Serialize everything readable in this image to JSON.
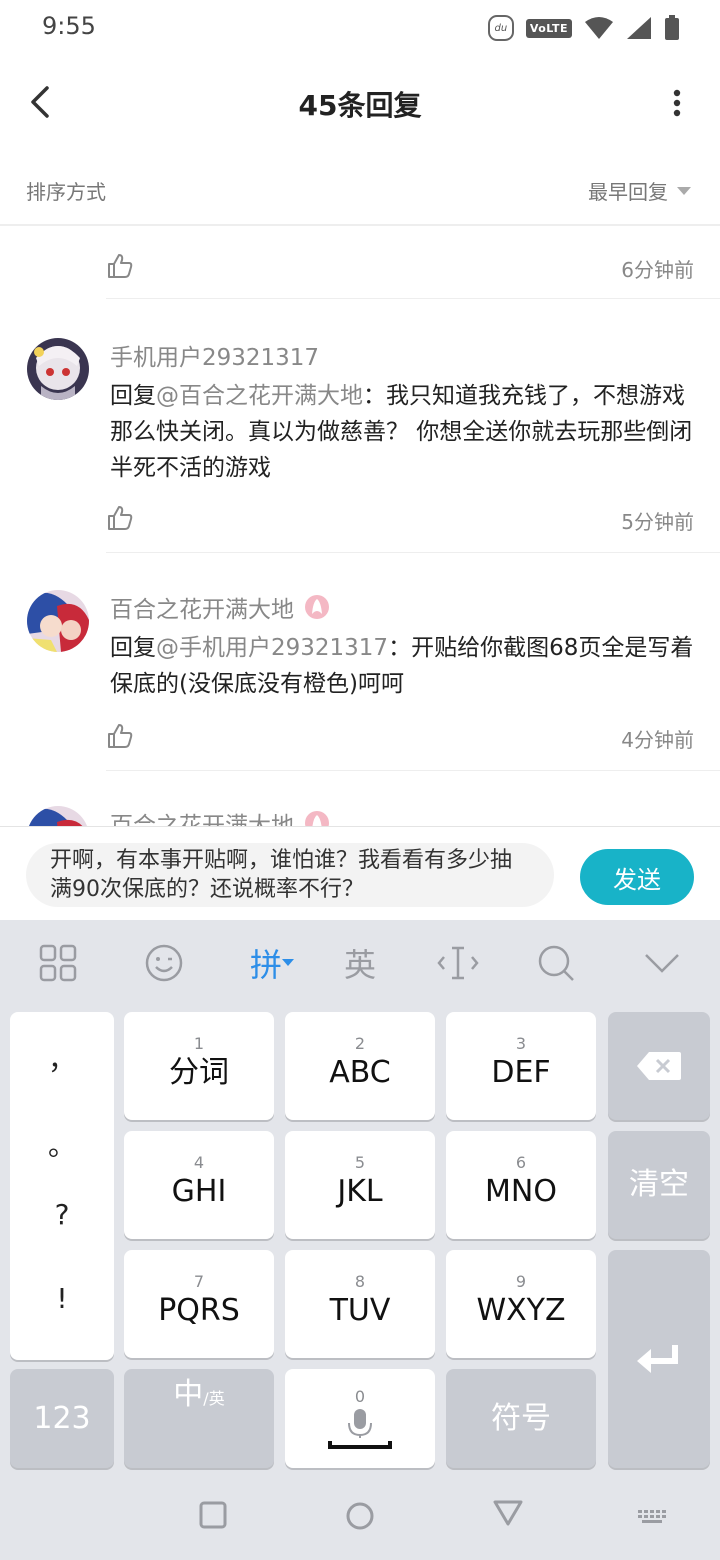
{
  "status_bar": {
    "time": "9:55",
    "du_badge": "du",
    "volte_badge": "VoLTE"
  },
  "header": {
    "title": "45条回复"
  },
  "sort": {
    "label": "排序方式",
    "value": "最早回复"
  },
  "comments": [
    {
      "time": "6分钟前"
    },
    {
      "user": "手机用户29321317",
      "reply_prefix": "回复",
      "mention": "@百合之花开满大地",
      "text": "：我只知道我充钱了，不想游戏那么快关闭。真以为做慈善？ 你想全送你就去玩那些倒闭半死不活的游戏",
      "time": "5分钟前"
    },
    {
      "user": "百合之花开满大地",
      "reply_prefix": "回复",
      "mention": "@手机用户29321317",
      "text": "：开贴给你截图68页全是写着保底的(没保底没有橙色)呵呵",
      "time": "4分钟前"
    },
    {
      "user": "百合之花开满大地"
    }
  ],
  "input": {
    "text": "开啊，有本事开贴啊，谁怕谁？我看看有多少抽满90次保底的？还说概率不行？",
    "send_label": "发送"
  },
  "keyboard": {
    "toolbar": {
      "pinyin": "拼",
      "english": "英"
    },
    "punctuation": [
      "，",
      "。",
      "?",
      "!"
    ],
    "keys": [
      {
        "num": "1",
        "label": "分词"
      },
      {
        "num": "2",
        "label": "ABC"
      },
      {
        "num": "3",
        "label": "DEF"
      },
      {
        "num": "4",
        "label": "GHI"
      },
      {
        "num": "5",
        "label": "JKL"
      },
      {
        "num": "6",
        "label": "MNO"
      },
      {
        "num": "7",
        "label": "PQRS"
      },
      {
        "num": "8",
        "label": "TUV"
      },
      {
        "num": "9",
        "label": "WXYZ"
      }
    ],
    "clear_label": "清空",
    "num_switch_label": "123",
    "lang_main": "中",
    "lang_sub": "/英",
    "space_num": "0",
    "symbols_label": "符号"
  },
  "colors": {
    "accent": "#18b3c8",
    "pinyin_active": "#2d8ee8",
    "keyboard_bg": "#e3e5ea"
  }
}
